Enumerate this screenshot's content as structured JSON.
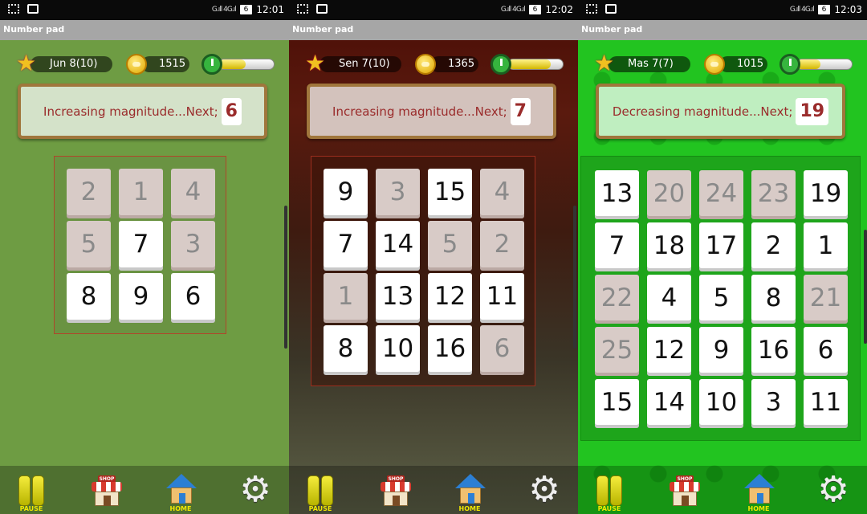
{
  "panels": [
    {
      "id": "p1",
      "statusbar": {
        "signal": "G.ıll 4G.ıl",
        "battery": "6",
        "time": "12:01"
      },
      "app_title": "Number pad",
      "hud": {
        "level": "Jun 8(10)",
        "coins": "1515",
        "timer_fraction": 0.48
      },
      "prompt": {
        "text": "Increasing magnitude...Next;",
        "next": "6"
      },
      "grid_size": 3,
      "tiles": [
        {
          "value": "2",
          "done": true
        },
        {
          "value": "1",
          "done": true
        },
        {
          "value": "4",
          "done": true
        },
        {
          "value": "5",
          "done": true
        },
        {
          "value": "7",
          "done": false
        },
        {
          "value": "3",
          "done": true
        },
        {
          "value": "8",
          "done": false
        },
        {
          "value": "9",
          "done": false
        },
        {
          "value": "6",
          "done": false
        }
      ],
      "bottom": {
        "pause": "PAUSE",
        "shop": "SHOP",
        "home": "HOME"
      }
    },
    {
      "id": "p2",
      "statusbar": {
        "signal": "G.ıll 4G.ıl",
        "battery": "6",
        "time": "12:02"
      },
      "app_title": "Number pad",
      "hud": {
        "level": "Sen 7(10)",
        "coins": "1365",
        "timer_fraction": 0.78
      },
      "prompt": {
        "text": "Increasing magnitude...Next;",
        "next": "7"
      },
      "grid_size": 4,
      "tiles": [
        {
          "value": "9",
          "done": false
        },
        {
          "value": "3",
          "done": true
        },
        {
          "value": "15",
          "done": false
        },
        {
          "value": "4",
          "done": true
        },
        {
          "value": "7",
          "done": false
        },
        {
          "value": "14",
          "done": false
        },
        {
          "value": "5",
          "done": true
        },
        {
          "value": "2",
          "done": true
        },
        {
          "value": "1",
          "done": true
        },
        {
          "value": "13",
          "done": false
        },
        {
          "value": "12",
          "done": false
        },
        {
          "value": "11",
          "done": false
        },
        {
          "value": "8",
          "done": false
        },
        {
          "value": "10",
          "done": false
        },
        {
          "value": "16",
          "done": false
        },
        {
          "value": "6",
          "done": true
        }
      ],
      "bottom": {
        "pause": "PAUSE",
        "shop": "SHOP",
        "home": "HOME"
      }
    },
    {
      "id": "p3",
      "statusbar": {
        "signal": "G.ıll 4G.ıl",
        "battery": "6",
        "time": "12:03"
      },
      "app_title": "Number pad",
      "hud": {
        "level": "Mas 7(7)",
        "coins": "1015",
        "timer_fraction": 0.42
      },
      "prompt": {
        "text": "Decreasing magnitude...Next;",
        "next": "19"
      },
      "grid_size": 5,
      "tiles": [
        {
          "value": "13",
          "done": false
        },
        {
          "value": "20",
          "done": true
        },
        {
          "value": "24",
          "done": true
        },
        {
          "value": "23",
          "done": true
        },
        {
          "value": "19",
          "done": false
        },
        {
          "value": "7",
          "done": false
        },
        {
          "value": "18",
          "done": false
        },
        {
          "value": "17",
          "done": false
        },
        {
          "value": "2",
          "done": false
        },
        {
          "value": "1",
          "done": false
        },
        {
          "value": "22",
          "done": true
        },
        {
          "value": "4",
          "done": false
        },
        {
          "value": "5",
          "done": false
        },
        {
          "value": "8",
          "done": false
        },
        {
          "value": "21",
          "done": true
        },
        {
          "value": "25",
          "done": true
        },
        {
          "value": "12",
          "done": false
        },
        {
          "value": "9",
          "done": false
        },
        {
          "value": "16",
          "done": false
        },
        {
          "value": "6",
          "done": false
        },
        {
          "value": "15",
          "done": false
        },
        {
          "value": "14",
          "done": false
        },
        {
          "value": "10",
          "done": false
        },
        {
          "value": "3",
          "done": false
        },
        {
          "value": "11",
          "done": false
        }
      ],
      "bottom": {
        "pause": "PAUSE",
        "shop": "SHOP",
        "home": "HOME"
      }
    }
  ]
}
